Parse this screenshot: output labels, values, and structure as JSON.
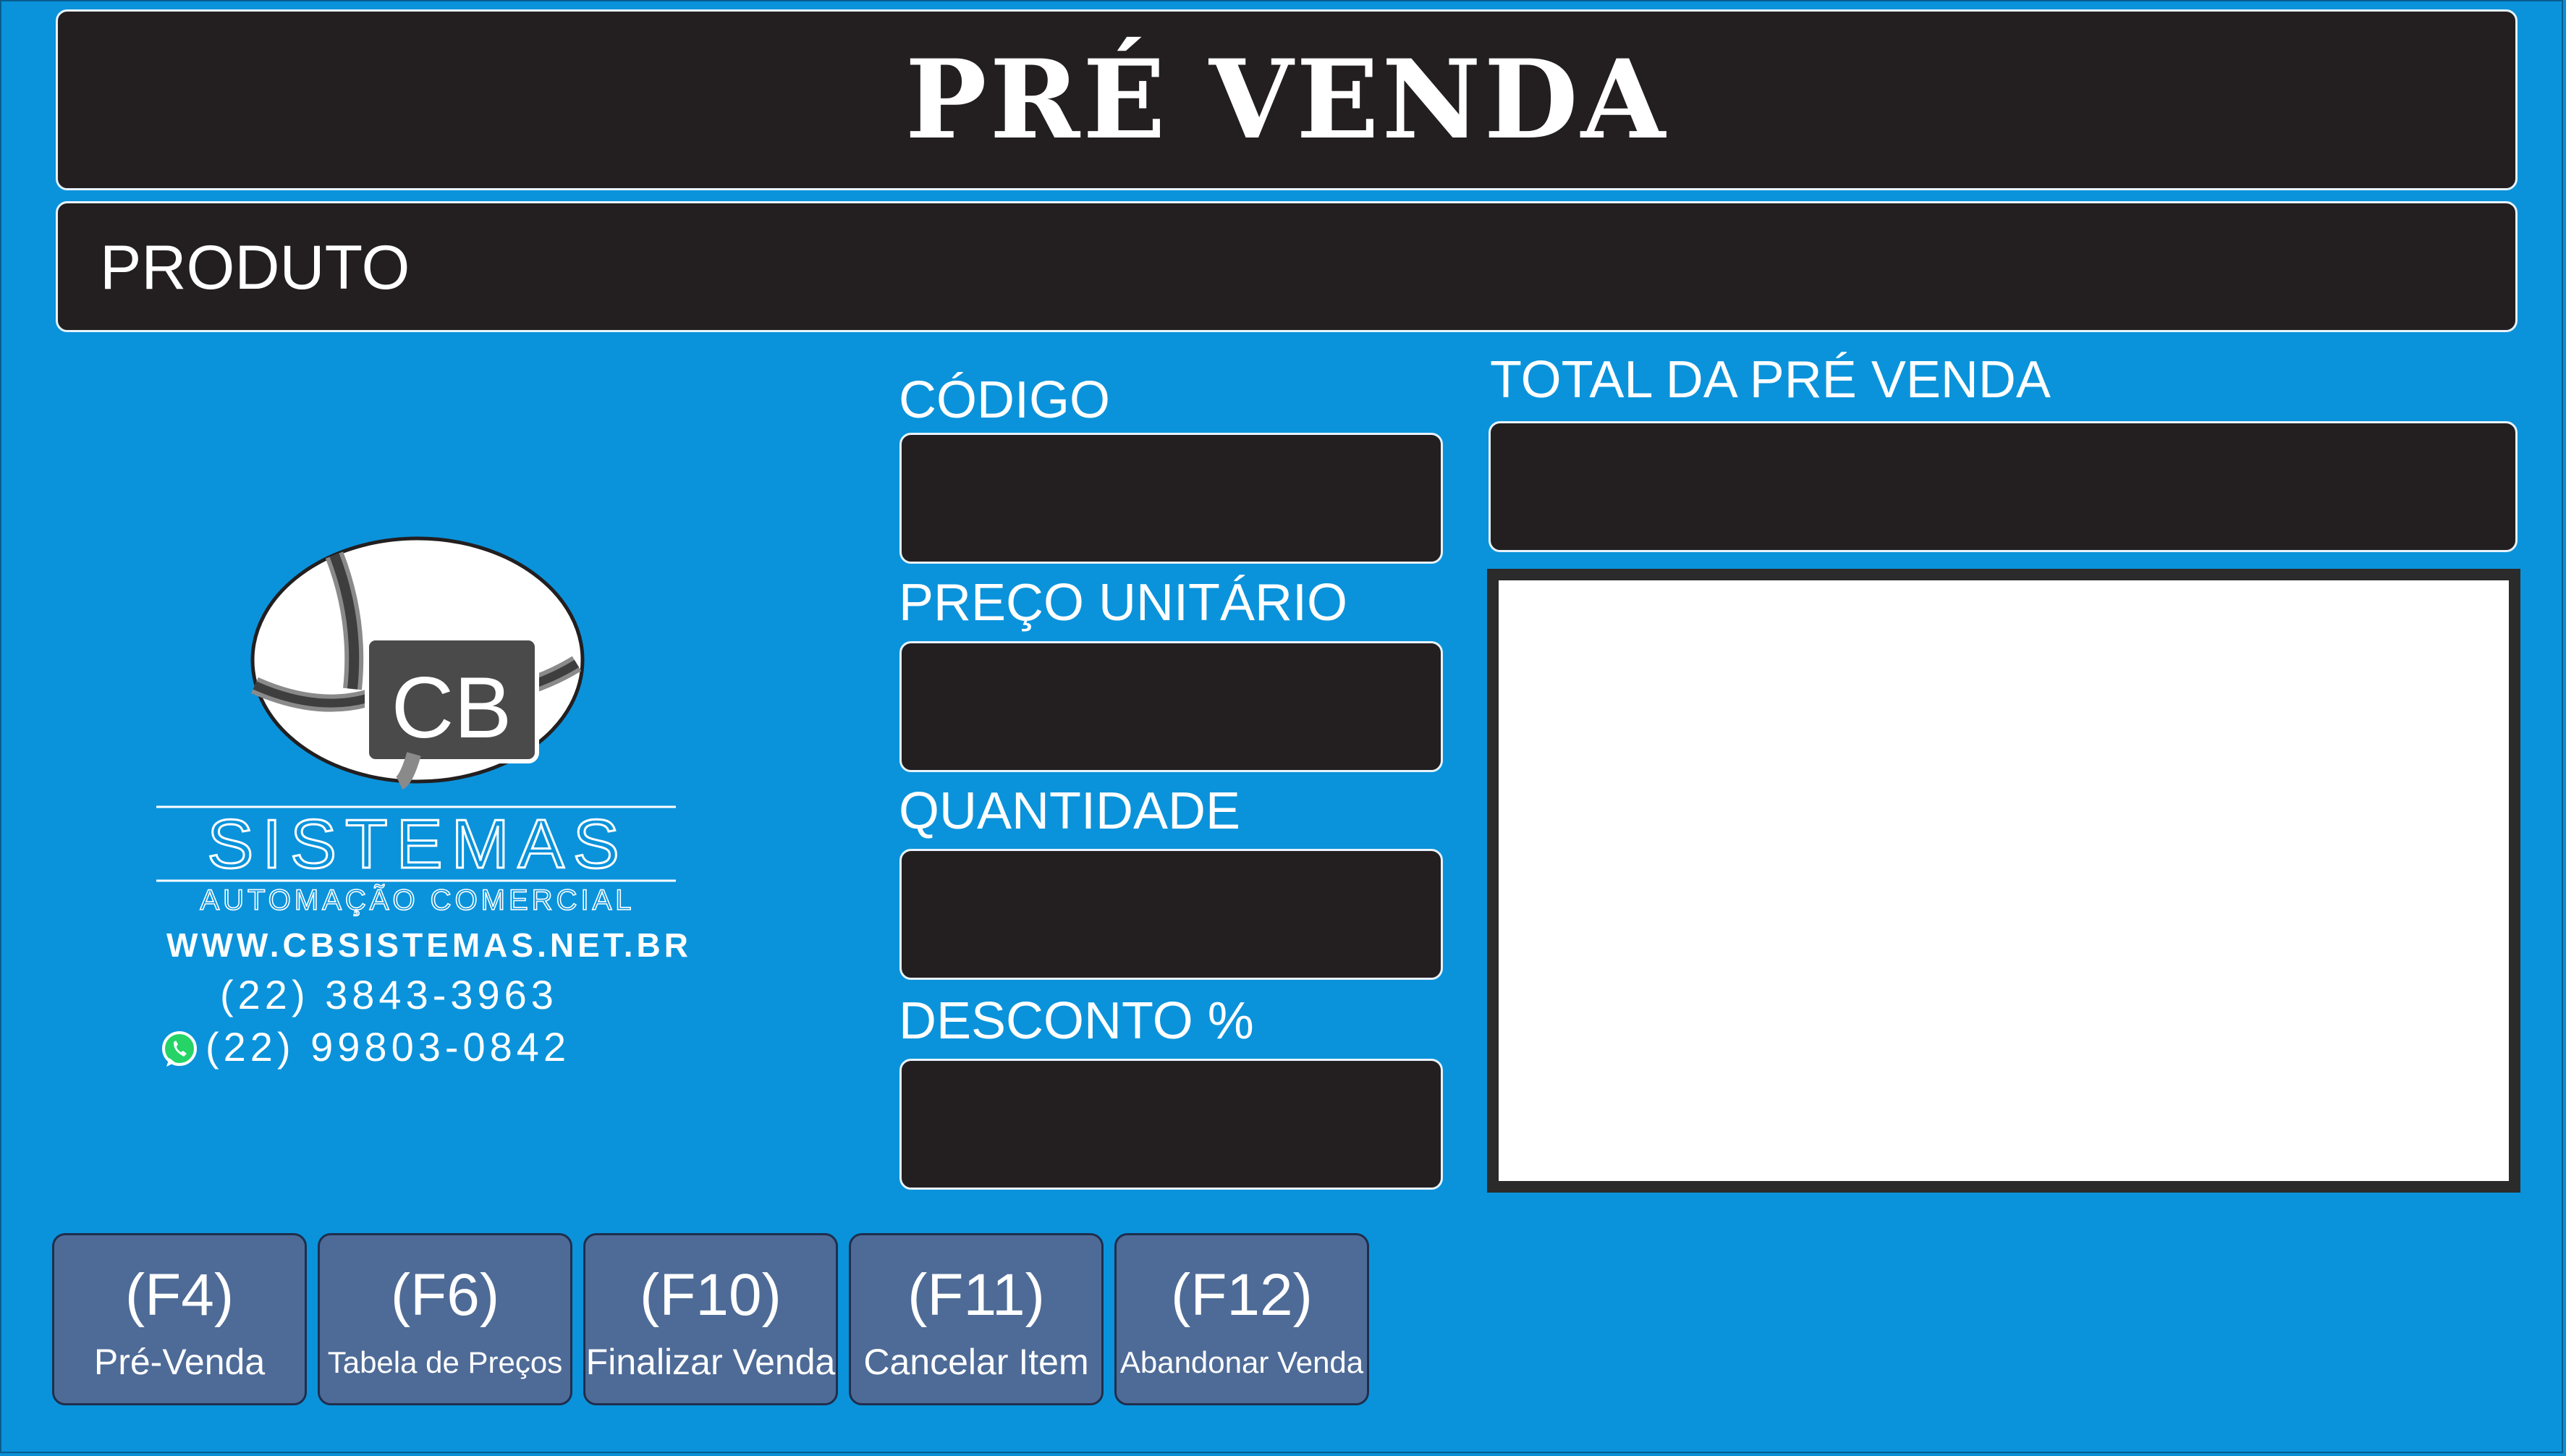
{
  "header": {
    "title": "PRÉ VENDA"
  },
  "produto": {
    "label": "PRODUTO"
  },
  "fields": {
    "codigo": "CÓDIGO",
    "preco_unitario": "PREÇO UNITÁRIO",
    "quantidade": "QUANTIDADE",
    "desconto": "DESCONTO %"
  },
  "total": {
    "label": "TOTAL DA PRÉ VENDA"
  },
  "company": {
    "logo_initials": "CB",
    "name": "SISTEMAS",
    "tagline": "AUTOMAÇÃO COMERCIAL",
    "website": "WWW.CBSISTEMAS.NET.BR",
    "phone": "(22) 3843-3963",
    "whatsapp": "(22) 99803-0842",
    "whatsapp_icon": "whatsapp-icon"
  },
  "function_keys": [
    {
      "key": "(F4)",
      "label": "Pré-Venda"
    },
    {
      "key": "(F6)",
      "label": "Tabela de Preços"
    },
    {
      "key": "(F10)",
      "label": "Finalizar Venda"
    },
    {
      "key": "(F11)",
      "label": "Cancelar Item"
    },
    {
      "key": "(F12)",
      "label": "Abandonar Venda"
    }
  ],
  "colors": {
    "background": "#0a93db",
    "panel": "#231f20",
    "function_key": "#4e6b97",
    "text": "#ffffff"
  }
}
